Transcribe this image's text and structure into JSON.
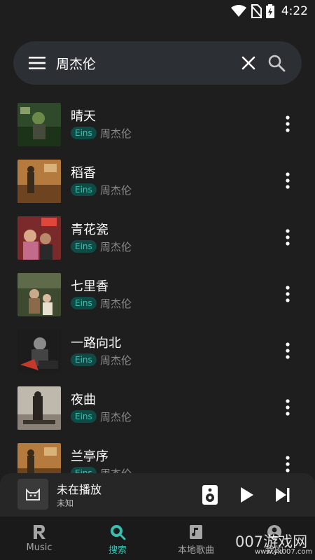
{
  "status_bar": {
    "time": "4:22"
  },
  "search": {
    "query": "周杰伦"
  },
  "songs": [
    {
      "title": "晴天",
      "source": "Eins",
      "artist": "周杰伦",
      "cover_color": "#2f4a2a"
    },
    {
      "title": "稻香",
      "source": "Eins",
      "artist": "周杰伦",
      "cover_color": "#8a5a2e"
    },
    {
      "title": "青花瓷",
      "source": "Eins",
      "artist": "周杰伦",
      "cover_color": "#7a2a2a"
    },
    {
      "title": "七里香",
      "source": "Eins",
      "artist": "周杰伦",
      "cover_color": "#3d4a2f"
    },
    {
      "title": "一路向北",
      "source": "Eins",
      "artist": "周杰伦",
      "cover_color": "#1c1c1c"
    },
    {
      "title": "夜曲",
      "source": "Eins",
      "artist": "周杰伦",
      "cover_color": "#bfb8ad"
    },
    {
      "title": "兰亭序",
      "source": "Eins",
      "artist": "周杰伦",
      "cover_color": "#8a5a2e"
    }
  ],
  "now_playing": {
    "title": "未在播放",
    "subtitle": "未知"
  },
  "nav": [
    {
      "label": "Music",
      "icon": "r-logo-icon",
      "active": false
    },
    {
      "label": "搜索",
      "icon": "search-icon",
      "active": true
    },
    {
      "label": "本地歌曲",
      "icon": "music-file-icon",
      "active": false
    },
    {
      "label": "我的",
      "icon": "profile-icon",
      "active": false
    }
  ],
  "colors": {
    "accent": "#37c0ae",
    "background": "#1e1e1e",
    "badge_bg": "#0f4a45"
  },
  "watermark": {
    "text": "007游戏网",
    "url": "www.yx007.com"
  }
}
